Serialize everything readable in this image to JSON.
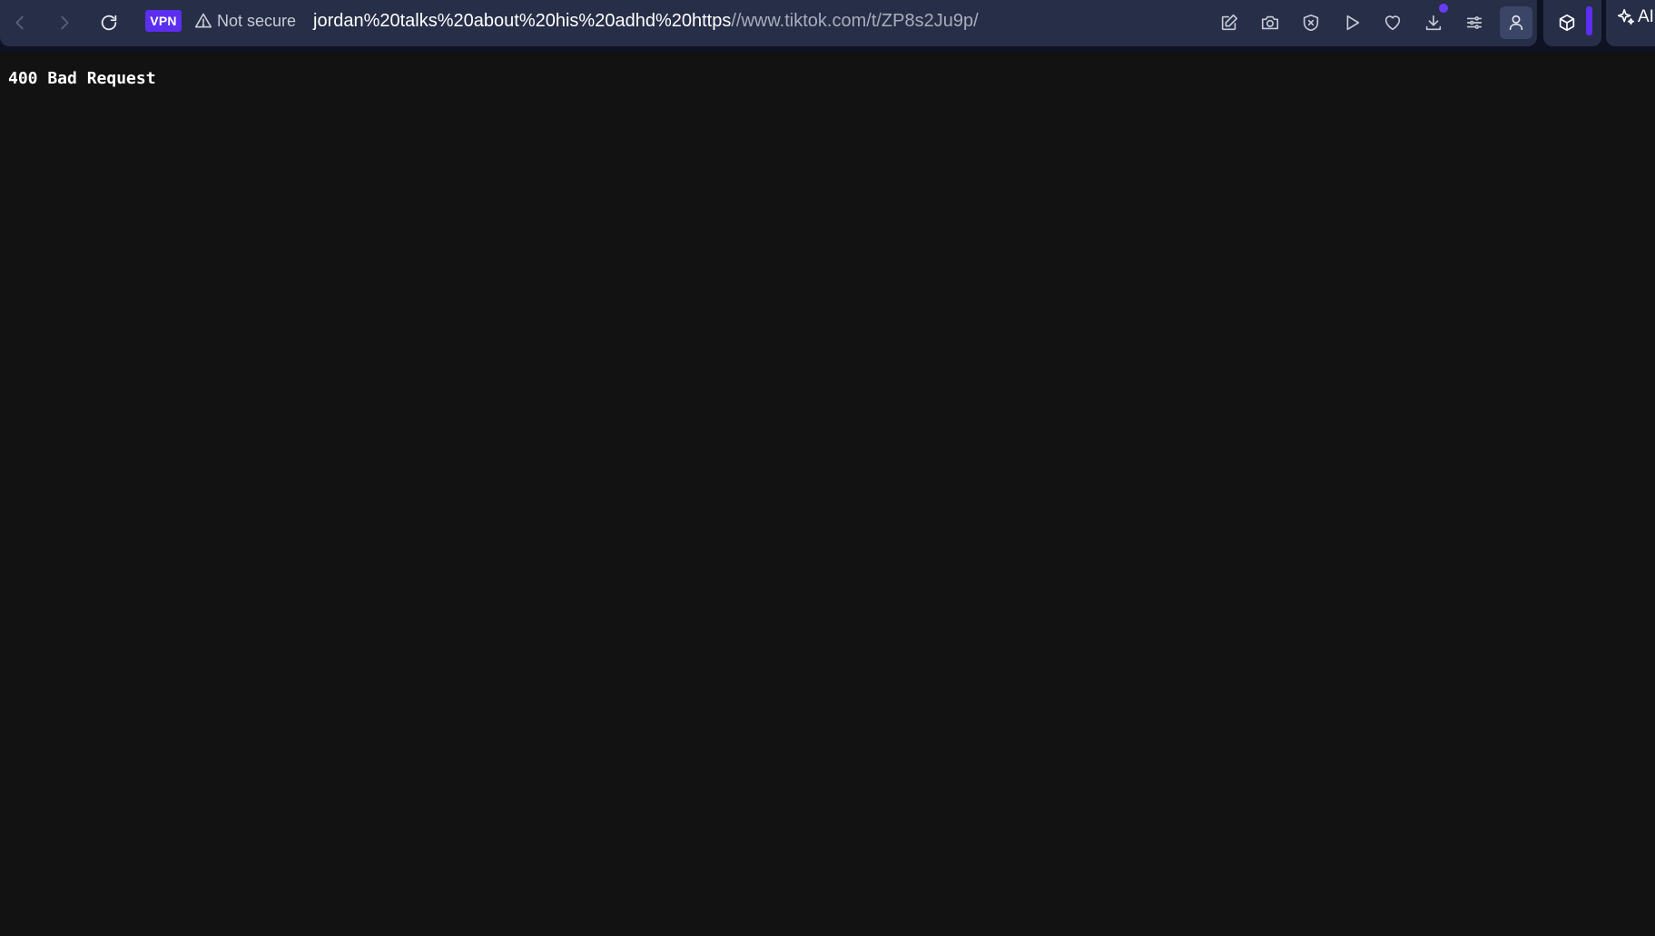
{
  "browser": {
    "vpn_label": "VPN",
    "security_label": "Not secure",
    "url_primary": "jordan%20talks%20about%20his%20adhd%20https",
    "url_rest": "//www.tiktok.com/t/ZP8s2Ju9p/",
    "ai_label": "AI",
    "icons": [
      "back-icon",
      "forward-icon",
      "reload-icon",
      "warning-icon",
      "edit-icon",
      "camera-icon",
      "shield-x-icon",
      "play-icon",
      "heart-icon",
      "download-icon",
      "menu-icon",
      "profile-icon",
      "cube-icon",
      "sparkle-icon"
    ],
    "accent_color": "#5b2ef0"
  },
  "page": {
    "message": "400 Bad Request"
  }
}
